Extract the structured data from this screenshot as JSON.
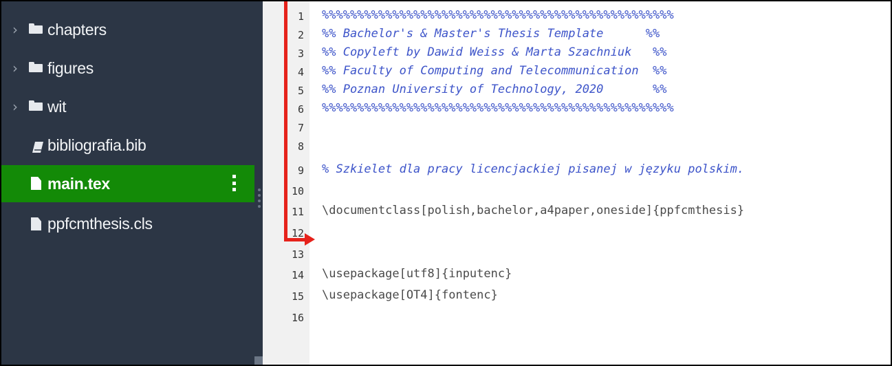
{
  "file_tree": {
    "items": [
      {
        "label": "chapters",
        "type": "folder",
        "icon": "folder-icon"
      },
      {
        "label": "figures",
        "type": "folder",
        "icon": "folder-icon"
      },
      {
        "label": "wit",
        "type": "folder",
        "icon": "folder-icon"
      },
      {
        "label": "bibliografia.bib",
        "type": "file",
        "icon": "book-icon"
      },
      {
        "label": "main.tex",
        "type": "file",
        "icon": "file-icon",
        "selected": true
      },
      {
        "label": "ppfcmthesis.cls",
        "type": "file",
        "icon": "file-icon"
      }
    ],
    "menu_icon": "kebab-menu-icon"
  },
  "editor": {
    "lines": [
      {
        "num": "1",
        "text": "%%%%%%%%%%%%%%%%%%%%%%%%%%%%%%%%%%%%%%%%%%%%%%%%%%"
      },
      {
        "num": "2",
        "text": "%% Bachelor's & Master's Thesis Template      %%"
      },
      {
        "num": "3",
        "text": "%% Copyleft by Dawid Weiss & Marta Szachniuk   %%"
      },
      {
        "num": "4",
        "text": "%% Faculty of Computing and Telecommunication  %%"
      },
      {
        "num": "5",
        "text": "%% Poznan University of Technology, 2020       %%"
      },
      {
        "num": "6",
        "text": "%%%%%%%%%%%%%%%%%%%%%%%%%%%%%%%%%%%%%%%%%%%%%%%%%%"
      },
      {
        "num": "7",
        "text": ""
      },
      {
        "num": "8",
        "text": ""
      },
      {
        "num": "9",
        "text": "% Szkielet dla pracy licencjackiej pisanej w języku polskim."
      },
      {
        "num": "10",
        "text": ""
      },
      {
        "num": "11",
        "text": "\\documentclass[polish,bachelor,a4paper,oneside]{ppfcmthesis}"
      },
      {
        "num": "12",
        "text": ""
      },
      {
        "num": "13",
        "text": ""
      },
      {
        "num": "14",
        "text": "\\usepackage[utf8]{inputenc}"
      },
      {
        "num": "15",
        "text": "\\usepackage[OT4]{fontenc}"
      },
      {
        "num": "16",
        "text": ""
      }
    ]
  },
  "colors": {
    "sidebar_bg": "#2c3645",
    "selected_bg": "#138a07",
    "comment": "#3d54c9",
    "annotation_arrow": "#e6221b"
  }
}
